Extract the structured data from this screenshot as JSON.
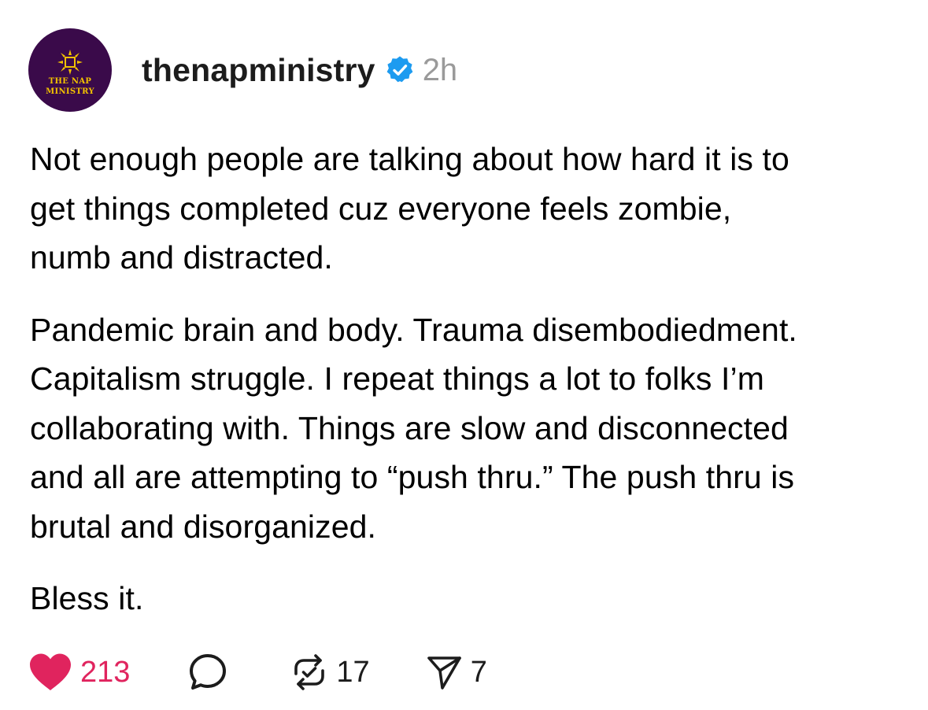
{
  "post": {
    "avatar": {
      "label_line1": "THE NAP",
      "label_line2": "MINISTRY",
      "background": "#3a0a4a",
      "accent": "#f2c200"
    },
    "username": "thenapministry",
    "verified_icon": "verified-badge-icon",
    "verified_color": "#1d9bf0",
    "time": "2h",
    "paragraphs": [
      "Not enough people are talking about how hard it is to\nget things completed cuz everyone feels zombie,\nnumb and distracted.",
      "Pandemic brain and body. Trauma disembodiedment.\nCapitalism struggle. I repeat things a lot to folks I’m\ncollaborating with. Things are slow and disconnected\nand all are attempting to “push thru.” The push thru is\nbrutal and disorganized.",
      "Bless it."
    ]
  },
  "actions": {
    "like": {
      "icon": "heart-icon",
      "count": "213",
      "color": "#e0245e",
      "active": true
    },
    "comment": {
      "icon": "comment-bubble-icon"
    },
    "repost": {
      "icon": "repost-icon",
      "count": "17"
    },
    "share": {
      "icon": "send-icon",
      "count": "7"
    }
  }
}
